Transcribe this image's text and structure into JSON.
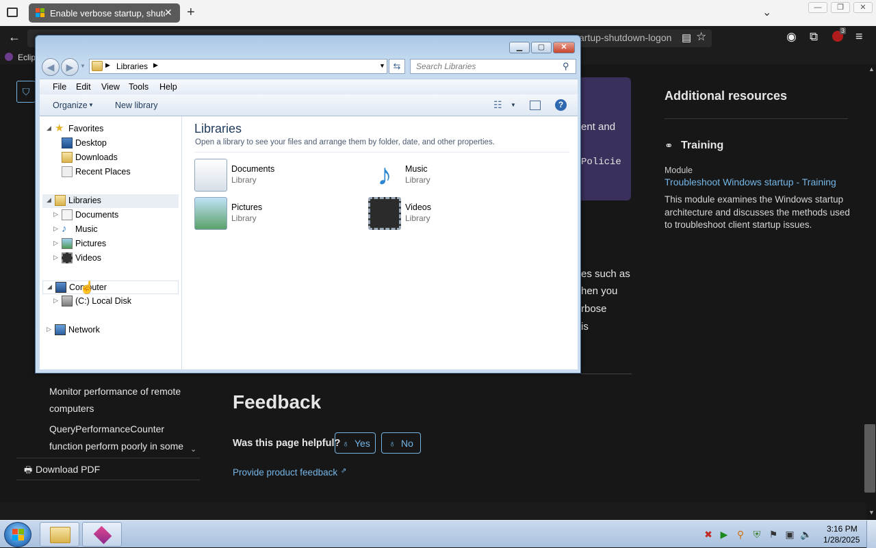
{
  "browser": {
    "tab_title": "Enable verbose startup, shutdown, logon, and logoff status messages",
    "url_fragment": "artup-shutdown-logon",
    "bookmark_label": "Eclip",
    "tab_close": "✕",
    "new_tab": "+",
    "notif_count": "3"
  },
  "page": {
    "right_heading": "Additional resources",
    "training_heading": "Training",
    "module_label": "Module",
    "module_link": "Troubleshoot Windows startup - Training",
    "module_desc": "This module examines the Windows startup architecture and discusses the methods used to troubleshoot client startup issues.",
    "callout_frag1": "ent and",
    "callout_frag2": "Policie",
    "body_frag1": "es such as",
    "body_frag2": "hen you",
    "body_frag3": "rbose",
    "body_frag4": "is",
    "toc_item1": "Monitor performance of remote computers",
    "toc_item2": "QueryPerformanceCounter function perform poorly in some",
    "download_pdf": "Download PDF",
    "feedback_title": "Feedback",
    "helpful_question": "Was this page helpful?",
    "yes_label": "Yes",
    "no_label": "No",
    "provide_feedback": "Provide product feedback"
  },
  "explorer": {
    "breadcrumb": "Libraries",
    "search_placeholder": "Search Libraries",
    "menu": [
      "File",
      "Edit",
      "View",
      "Tools",
      "Help"
    ],
    "organize": "Organize",
    "new_library": "New library",
    "nav": {
      "favorites": "Favorites",
      "desktop": "Desktop",
      "downloads": "Downloads",
      "recent": "Recent Places",
      "libraries": "Libraries",
      "documents": "Documents",
      "music": "Music",
      "pictures": "Pictures",
      "videos": "Videos",
      "computer": "Computer",
      "local_disk": "(C:) Local Disk",
      "network": "Network"
    },
    "content_title": "Libraries",
    "content_subtitle": "Open a library to see your files and arrange them by folder, date, and other properties.",
    "libraries": [
      {
        "name": "Documents",
        "type": "Library"
      },
      {
        "name": "Music",
        "type": "Library"
      },
      {
        "name": "Pictures",
        "type": "Library"
      },
      {
        "name": "Videos",
        "type": "Library"
      }
    ]
  },
  "taskbar": {
    "time": "3:16 PM",
    "date": "1/28/2025"
  },
  "colors": {
    "link": "#75b6e7",
    "accent_purple": "#3b2f5c",
    "explorer_title": "#1e395b"
  }
}
